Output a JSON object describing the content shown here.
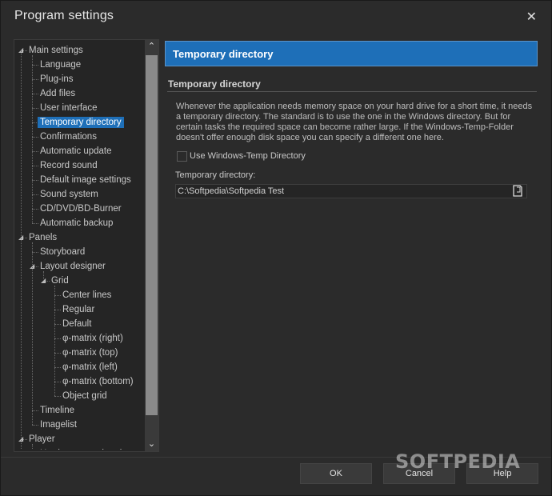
{
  "window": {
    "title": "Program settings",
    "close_glyph": "✕"
  },
  "tree": {
    "items": [
      {
        "label": "Main settings",
        "level": 0,
        "expanded": true
      },
      {
        "label": "Language",
        "level": 1
      },
      {
        "label": "Plug-ins",
        "level": 1
      },
      {
        "label": "Add files",
        "level": 1
      },
      {
        "label": "User interface",
        "level": 1
      },
      {
        "label": "Temporary directory",
        "level": 1,
        "selected": true
      },
      {
        "label": "Confirmations",
        "level": 1
      },
      {
        "label": "Automatic update",
        "level": 1
      },
      {
        "label": "Record sound",
        "level": 1
      },
      {
        "label": "Default image settings",
        "level": 1
      },
      {
        "label": "Sound system",
        "level": 1
      },
      {
        "label": "CD/DVD/BD-Burner",
        "level": 1
      },
      {
        "label": "Automatic backup",
        "level": 1
      },
      {
        "label": "Panels",
        "level": 0,
        "expanded": true
      },
      {
        "label": "Storyboard",
        "level": 1
      },
      {
        "label": "Layout designer",
        "level": 1,
        "expanded": true
      },
      {
        "label": "Grid",
        "level": 2,
        "expanded": true
      },
      {
        "label": "Center lines",
        "level": 3
      },
      {
        "label": "Regular",
        "level": 3
      },
      {
        "label": "Default",
        "level": 3
      },
      {
        "label": "φ-matrix (right)",
        "level": 3
      },
      {
        "label": "φ-matrix (top)",
        "level": 3
      },
      {
        "label": "φ-matrix (left)",
        "level": 3
      },
      {
        "label": "φ-matrix (bottom)",
        "level": 3
      },
      {
        "label": "Object grid",
        "level": 3
      },
      {
        "label": "Timeline",
        "level": 1
      },
      {
        "label": "Imagelist",
        "level": 1
      },
      {
        "label": "Player",
        "level": 0,
        "expanded": true
      },
      {
        "label": "Hardware acceleration",
        "level": 1
      }
    ]
  },
  "content": {
    "header": "Temporary directory",
    "section_title": "Temporary directory",
    "description": "Whenever the application needs memory space on your hard drive for a short time, it needs a temporary directory. The standard is to use the one in the Windows directory. But for certain tasks the required space can become rather large. If the Windows-Temp-Folder doesn't offer enough disk space you can specify a different one here.",
    "checkbox_label": "Use Windows-Temp Directory",
    "checkbox_checked": false,
    "dir_label": "Temporary directory:",
    "dir_value": "C:\\Softpedia\\Softpedia Test",
    "browse_icon": "folder-icon"
  },
  "footer": {
    "ok_label": "OK",
    "cancel_label": "Cancel",
    "help_label": "Help"
  },
  "watermark": "SOFTPEDIA",
  "colors": {
    "accent": "#1e6fb8",
    "background": "#2b2b2b"
  }
}
